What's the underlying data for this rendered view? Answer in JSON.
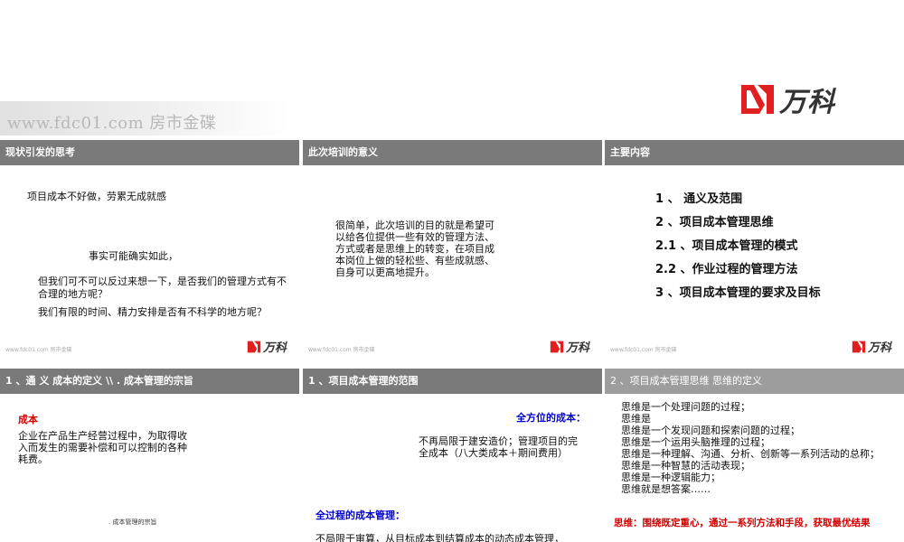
{
  "header": {
    "watermark": "www.fdc01.com 房市金碟",
    "logo_text": "万科",
    "logo_color": "#e02020"
  },
  "slides": [
    {
      "title": "现状引发的思考",
      "lines": [
        "项目成本不好做，劳累无成就感",
        "事实可能确实如此，",
        "但我们可不可以反过来想一下，是否我们的管理方式有不",
        "合理的地方呢？",
        "我们有限的时间、精力安排是否有不科学的地方呢？"
      ],
      "footer_watermark": "www.fdc01.com 房市金碟",
      "footer_logo": "万科"
    },
    {
      "title": "此次培训的意义",
      "lines": [
        "很简单，此次培训的目的就是希望可",
        "以给各位提供一些有效的管理方法、",
        "方式或者是思维上的转变，在项目成",
        "本岗位上做的轻松些、有些成就感、",
        "自身可以更高地提升。"
      ],
      "footer_watermark": "www.fdc01.com 房市金碟",
      "footer_logo": "万科"
    },
    {
      "title": "主要内容",
      "items": [
        "1 、  通义及范围",
        "2 、项目成本管理思维",
        "2.1 、项目成本管理的模式",
        "2.2 、作业过程的管理方法",
        "3 、项目成本管理的要求及目标"
      ],
      "footer_watermark": "www.fdc01.com 房市金碟",
      "footer_logo": "万科"
    },
    {
      "title": "1 、通  义  成本的定义  \\\\    . 成本管理的宗旨",
      "heading": "成本",
      "lines": [
        "企业在产品生产经营过程中，为取得收",
        "入而发生的需要补偿和可以控制的各种",
        "耗费。"
      ],
      "note": ". 成本管理的宗旨"
    },
    {
      "title": "1 、项目成本管理的范围",
      "heading1": "全方位的成本：",
      "lines1": [
        "不再局限于建安造价；管理项目的完",
        "全成本（八大类成本＋期间费用）"
      ],
      "heading2": "全过程的成本管理：",
      "line2": "不局限于审算，从目标成本到结算成本的动态成本管理，"
    },
    {
      "title": "2 、项目成本管理思维      思维的定义",
      "lines": [
        "思维是一个处理问题的过程；",
        "思维是",
        "思维是一个发现问题和探索问题的过程；",
        "思维是一个运用头脑推理的过程；",
        "思维是一种理解、沟通、分析、创新等一系列活动的总称；",
        "思维是一种智慧的活动表现；",
        "思维是一种逻辑能力；",
        "思维就是想答案……"
      ],
      "conclusion": "思维：围绕既定重心，通过一系列方法和手段，获取最优结果"
    }
  ]
}
